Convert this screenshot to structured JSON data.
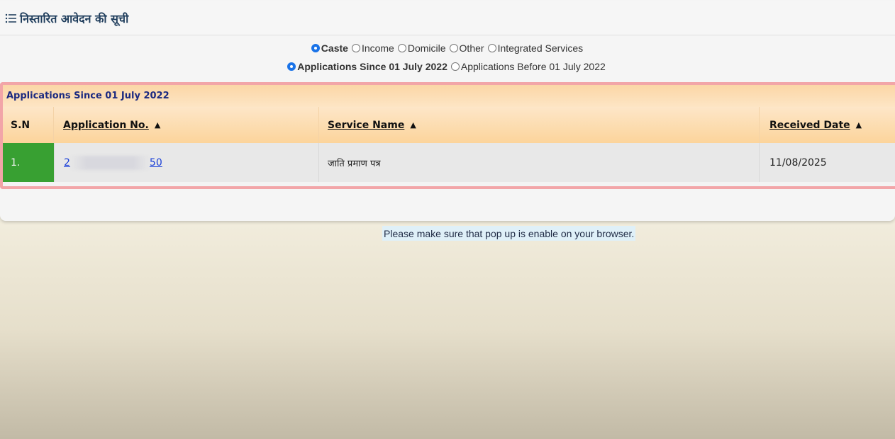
{
  "header": {
    "title": "निस्तारित आवेदन की सूची",
    "icon": "list-icon"
  },
  "service_filter": {
    "options": [
      {
        "label": "Caste",
        "checked": true
      },
      {
        "label": "Income",
        "checked": false
      },
      {
        "label": "Domicile",
        "checked": false
      },
      {
        "label": "Other",
        "checked": false
      },
      {
        "label": "Integrated Services",
        "checked": false
      }
    ]
  },
  "period_filter": {
    "options": [
      {
        "label": "Applications Since 01 July 2022",
        "checked": true
      },
      {
        "label": "Applications Before 01 July 2022",
        "checked": false
      }
    ]
  },
  "table": {
    "caption": "Applications Since 01 July 2022",
    "columns": [
      "S.N",
      "Application No.",
      "Service Name",
      "Received Date"
    ],
    "sort_icon": "sort-icon",
    "rows": [
      {
        "sn": "1.",
        "application_prefix": "2",
        "application_suffix": "50",
        "service_name": "जाति प्रमाण पत्र",
        "received_date": "11/08/2025"
      }
    ]
  },
  "footer_note": "Please make sure that pop up is enable on your browser.",
  "colors": {
    "radio_selected": "#1a73e8",
    "table_border": "#f2a5a8",
    "sn_cell": "#38a032",
    "link": "#1a3fd8",
    "caption_text": "#1c2a80"
  }
}
